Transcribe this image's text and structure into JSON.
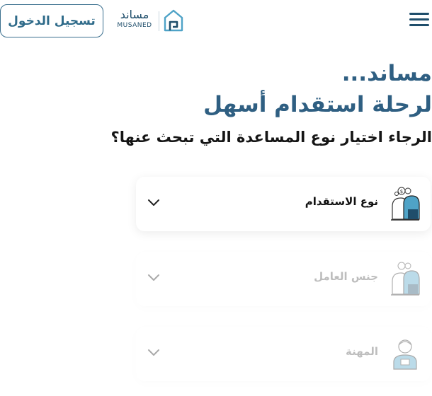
{
  "header": {
    "login_label": "تسجيل الدخول",
    "logo_ar": "مساند",
    "logo_en": "MUSANED"
  },
  "hero": {
    "line1": "مساند...",
    "line2": "لرحلة استقدام أسهل"
  },
  "question": "الرجاء اختيار نوع المساعدة التي تبحث عنها؟",
  "cards": [
    {
      "label": "نوع الاستقدام",
      "icon": "recruitment-type-icon",
      "state": "active"
    },
    {
      "label": "جنس العامل",
      "icon": "worker-gender-icon",
      "state": "disabled"
    },
    {
      "label": "المهنة",
      "icon": "profession-icon",
      "state": "disabled"
    }
  ],
  "colors": {
    "brand": "#2f5f82",
    "brand_dark": "#1f4e6b",
    "accent": "#4fa3c7"
  }
}
